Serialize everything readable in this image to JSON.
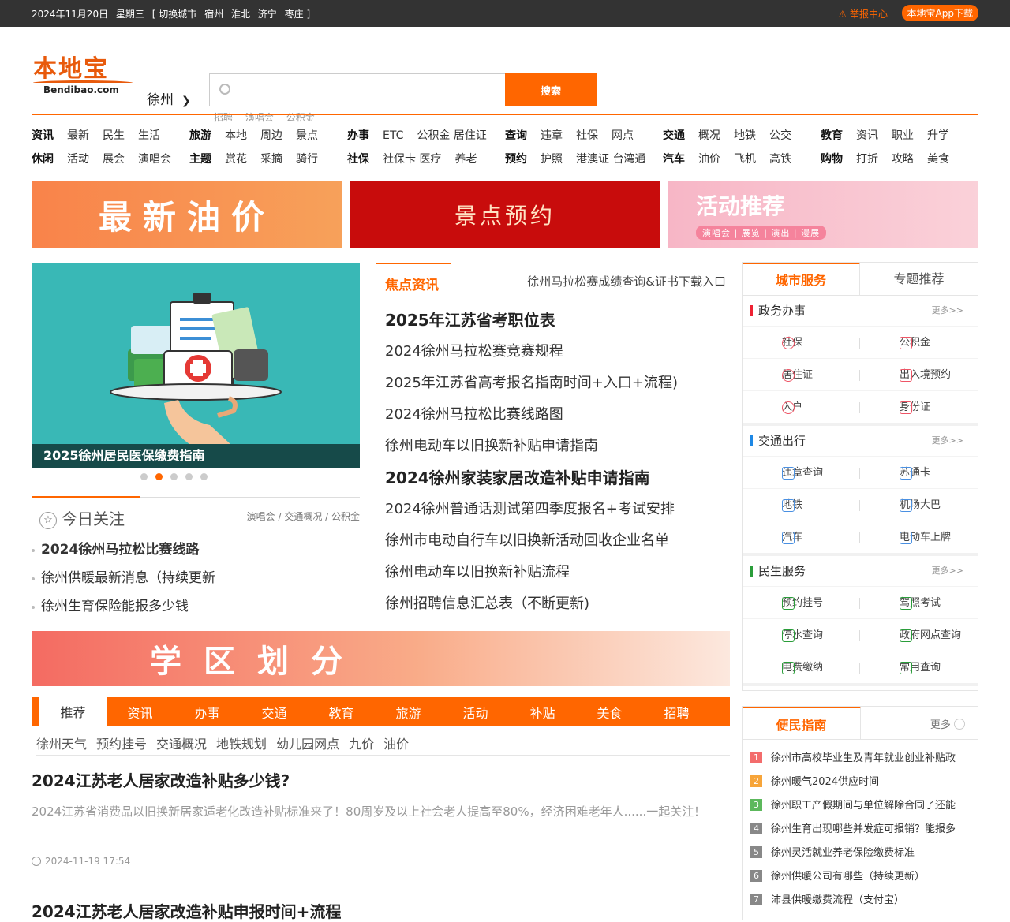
{
  "topbar": {
    "date": "2024年11月20日",
    "weekday": "星期三",
    "switch_label": "[ 切换城市",
    "cities": [
      "宿州",
      "淮北",
      "济宁",
      "枣庄 ]"
    ],
    "report": "举报中心",
    "app": "本地宝App下载"
  },
  "header": {
    "logo_cn": "本地宝",
    "logo_en": "Bendibao.com",
    "city": "徐州",
    "search": {
      "placeholder": "",
      "button": "搜索"
    },
    "hotwords": [
      "招聘",
      "演唱会",
      "公积金"
    ]
  },
  "nav": [
    {
      "row1": [
        "资讯",
        "最新",
        "民生",
        "生活"
      ],
      "row2": [
        "休闲",
        "活动",
        "展会",
        "演唱会"
      ]
    },
    {
      "row1": [
        "旅游",
        "本地",
        "周边",
        "景点"
      ],
      "row2": [
        "主题",
        "赏花",
        "采摘",
        "骑行"
      ]
    },
    {
      "row1": [
        "办事",
        "ETC",
        "公积金 居住证"
      ],
      "row2": [
        "社保",
        "社保卡 医疗",
        "养老"
      ]
    },
    {
      "row1": [
        "查询",
        "违章",
        "社保",
        "网点"
      ],
      "row2": [
        "预约",
        "护照",
        "港澳证 台湾通"
      ]
    },
    {
      "row1": [
        "交通",
        "概况",
        "地铁",
        "公交"
      ],
      "row2": [
        "汽车",
        "油价",
        "飞机",
        "高铁"
      ]
    },
    {
      "row1": [
        "教育",
        "资讯",
        "职业",
        "升学"
      ],
      "row2": [
        "购物",
        "打折",
        "攻略",
        "美食"
      ]
    }
  ],
  "banners": {
    "oil": "最新油价",
    "scenic": "景点预约",
    "activity": "活动推荐",
    "activity_sub": "演唱会 | 展览 | 演出 | 漫展"
  },
  "slider": {
    "caption": "2025徐州居民医保缴费指南",
    "dots": 5,
    "active": 1
  },
  "today": {
    "title": "今日关注",
    "tags": "演唱会 / 交通概况 / 公积金",
    "items": [
      "2024徐州马拉松比赛线路",
      "徐州供暖最新消息（持续更新",
      "徐州生育保险能报多少钱"
    ]
  },
  "focus": {
    "tab": "焦点资讯",
    "marquee": "徐州马拉松赛成绩查询&证书下载入口",
    "items": [
      {
        "text": "2025年江苏省考职位表",
        "bold": true
      },
      {
        "text": "2024徐州马拉松赛竞赛规程",
        "bold": false
      },
      {
        "text": "2025年江苏省高考报名指南时间+入口+流程)",
        "bold": false
      },
      {
        "text": "2024徐州马拉松比赛线路图",
        "bold": false
      },
      {
        "text": "徐州电动车以旧换新补贴申请指南",
        "bold": false
      },
      {
        "text": "2024徐州家装家居改造补贴申请指南",
        "bold": true
      },
      {
        "text": "2024徐州普通话测试第四季度报名+考试安排",
        "bold": false
      },
      {
        "text": "徐州市电动自行车以旧换新活动回收企业名单",
        "bold": false
      },
      {
        "text": "徐州电动车以旧换新补贴流程",
        "bold": false
      },
      {
        "text": "徐州招聘信息汇总表（不断更新)",
        "bold": false
      }
    ]
  },
  "wide_banner": "学区划分",
  "tabs": [
    "推荐",
    "资讯",
    "办事",
    "交通",
    "教育",
    "旅游",
    "活动",
    "补贴",
    "美食",
    "招聘"
  ],
  "sublinks": [
    "徐州天气",
    "预约挂号",
    "交通概况",
    "地铁规划",
    "幼儿园网点",
    "九价",
    "油价"
  ],
  "articles": [
    {
      "title": "2024江苏老人居家改造补贴多少钱?",
      "desc": "2024江苏省消费品以旧换新居家适老化改造补贴标准来了！80周岁及以上社会老人提高至80%，经济困难老年人......一起关注！",
      "time": "2024-11-19 17:54"
    },
    {
      "title": "2024江苏老人居家改造补贴申报时间+流程"
    }
  ],
  "sidebar": {
    "tabs": [
      "城市服务",
      "专题推荐"
    ],
    "more": "更多>>",
    "sections": [
      {
        "title": "政务办事",
        "items": [
          "社保",
          "公积金",
          "居住证",
          "出入境预约",
          "入户",
          "身份证"
        ]
      },
      {
        "title": "交通出行",
        "items": [
          "违章查询",
          "苏通卡",
          "地铁",
          "机场大巴",
          "汽车",
          "电动车上牌"
        ]
      },
      {
        "title": "民生服务",
        "items": [
          "预约挂号",
          "驾照考试",
          "停水查询",
          "政府网点查询",
          "电费缴纳",
          "常用查询"
        ]
      }
    ]
  },
  "guide": {
    "title": "便民指南",
    "more": "更多",
    "items": [
      "徐州市高校毕业生及青年就业创业补贴政",
      "徐州暖气2024供应时间",
      "徐州职工产假期间与单位解除合同了还能",
      "徐州生育出现哪些并发症可报销？能报多",
      "徐州灵活就业养老保险缴费标准",
      "徐州供暖公司有哪些（持续更新）",
      "沛县供暖缴费流程（支付宝）"
    ],
    "num_colors": [
      "#f36c6c",
      "#f7a53a",
      "#5cb85c",
      "#888888",
      "#888888",
      "#888888",
      "#888888"
    ]
  }
}
